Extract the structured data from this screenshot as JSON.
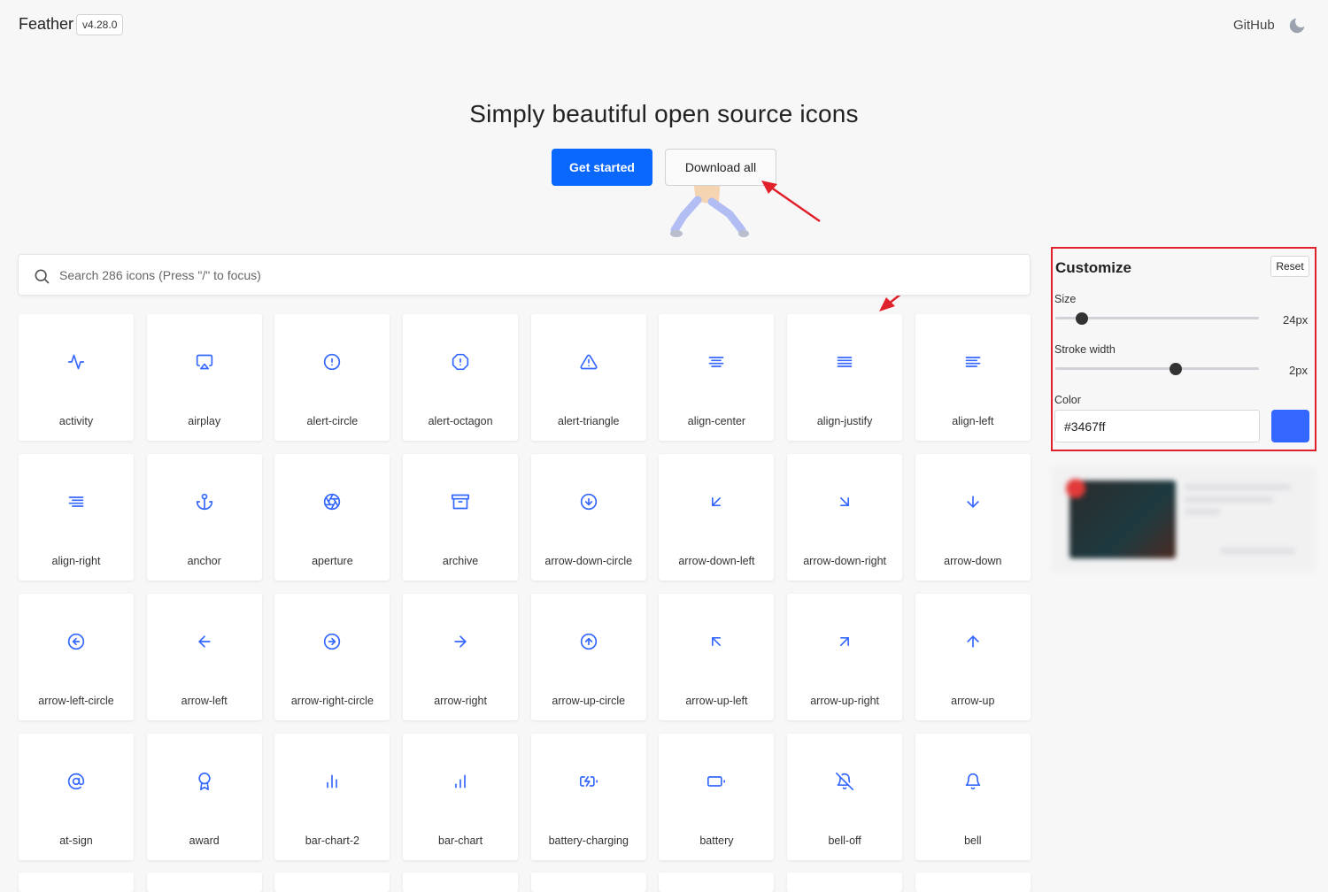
{
  "header": {
    "brand": "Feather",
    "version": "v4.28.0",
    "github_label": "GitHub",
    "theme_icon": "moon-icon"
  },
  "hero": {
    "title": "Simply beautiful open source icons",
    "primary_button": "Get started",
    "secondary_button": "Download all"
  },
  "search": {
    "placeholder": "Search 286 icons (Press \"/\" to focus)"
  },
  "icons": [
    "activity",
    "airplay",
    "alert-circle",
    "alert-octagon",
    "alert-triangle",
    "align-center",
    "align-justify",
    "align-left",
    "align-right",
    "anchor",
    "aperture",
    "archive",
    "arrow-down-circle",
    "arrow-down-left",
    "arrow-down-right",
    "arrow-down",
    "arrow-left-circle",
    "arrow-left",
    "arrow-right-circle",
    "arrow-right",
    "arrow-up-circle",
    "arrow-up-left",
    "arrow-up-right",
    "arrow-up",
    "at-sign",
    "award",
    "bar-chart-2",
    "bar-chart",
    "battery-charging",
    "battery",
    "bell-off",
    "bell"
  ],
  "customize": {
    "title": "Customize",
    "reset_label": "Reset",
    "size_label": "Size",
    "size_value": "24px",
    "size_fraction": 0.13,
    "stroke_label": "Stroke width",
    "stroke_value": "2px",
    "stroke_fraction": 0.59,
    "color_label": "Color",
    "color_value": "#3467ff"
  },
  "colors": {
    "accent": "#3467ff",
    "primary_button": "#0b68ff",
    "annotation": "#e0202a"
  }
}
